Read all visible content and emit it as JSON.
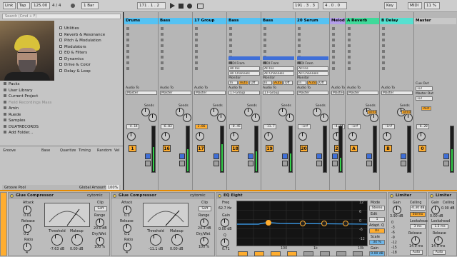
{
  "toolbar": {
    "link": "Link",
    "tap": "Tap",
    "tempo": "125.00",
    "meter_num": "4",
    "meter_den": "4",
    "bar": "1 Bar",
    "position": "171 . 1 . 2",
    "loop_pos": "191 . 3 . 3",
    "loop_len": "4 . 0 . 0",
    "key": "Key",
    "midi": "MIDI",
    "cpu": "11 %"
  },
  "browser": {
    "search_placeholder": "Search (Cmd + F)",
    "items": [
      "Utilities",
      "Reverb & Resonance",
      "Pitch & Modulation",
      "Modulators",
      "EQ & Filters",
      "Dynamics",
      "Drive & Color",
      "Delay & Loop"
    ],
    "places": [
      {
        "label": "Packs"
      },
      {
        "label": "User Library"
      },
      {
        "label": "Current Project"
      },
      {
        "label": "Field Recordings Mass",
        "dim": true
      },
      {
        "label": "Amin"
      },
      {
        "label": "Ruede"
      },
      {
        "label": "Samples"
      },
      {
        "label": "DUATRECORDS"
      },
      {
        "label": "Add Folder..."
      }
    ]
  },
  "groove": {
    "cols": [
      "Groove",
      "Base",
      "Quantize",
      "Timing",
      "Random",
      "Vel"
    ],
    "pool": "Groove Pool",
    "global_amount_label": "Global Amount",
    "global_amount": "100%"
  },
  "tracks": [
    {
      "name": "Drums",
      "color": "#55c2f3",
      "audio_to": "Audio To",
      "out": "Master",
      "vol": "-4.14",
      "num": "1",
      "lvl": 0.55
    },
    {
      "name": "Bass",
      "color": "#55c2f3",
      "audio_to": "Audio To",
      "out": "Master",
      "vol": "-6.03",
      "num": "16",
      "lvl": 0.5
    },
    {
      "name": "17 Group",
      "color": "#55c2f3",
      "audio_to": "Audio To",
      "out": "Master",
      "vol": "2.86",
      "num": "17",
      "lvl": 0.62,
      "volhi": true
    },
    {
      "name": "Bass",
      "color": "#55c2f3",
      "midi_from": "MIDI From",
      "midi_from_v": "All Ins",
      "midi_ch": "All Channels",
      "monitor": "Monitor",
      "in": "In",
      "auto": "Auto",
      "off": "Off",
      "audio_to": "Audio To",
      "out": "17-Group",
      "vol": "-0.45",
      "num": "18",
      "lvl": 0.45
    },
    {
      "name": "Bass",
      "color": "#55c2f3",
      "midi_from": "MIDI From",
      "midi_from_v": "All Ins",
      "midi_ch": "All Channels",
      "monitor": "Monitor",
      "in": "In",
      "auto": "Auto",
      "off": "Off",
      "audio_to": "Audio To",
      "out": "17-Group",
      "vol": "-11.7",
      "num": "19",
      "lvl": 0.4
    },
    {
      "name": "20 Serum",
      "color": "#55c2f3",
      "midi_from": "MIDI From",
      "midi_from_v": "All Ins",
      "midi_ch": "All Channels",
      "monitor": "Monitor",
      "in": "In",
      "auto": "Auto",
      "off": "Off",
      "audio_to": "Audio To",
      "out": "Master",
      "vol": "-inf",
      "num": "20",
      "lvl": 0.0
    },
    {
      "name": "Melodic",
      "color": "#b39ee9",
      "audio_to": "Audio To",
      "out": "Master",
      "vol": "-4.44",
      "num": "21",
      "lvl": 0.3
    },
    {
      "name": "A Reverb",
      "color": "#3fd99a",
      "audio_to": "Audio To",
      "out": "Master",
      "vol": "-inf",
      "num": "A",
      "lvl": 0.0
    },
    {
      "name": "B Delay",
      "color": "#56e0d0",
      "audio_to": "Audio To",
      "out": "Master",
      "vol": "-inf",
      "num": "B",
      "lvl": 0.0
    },
    {
      "name": "Master",
      "color": "#c8c8c8",
      "cue_out": "Cue Out",
      "cue_v": "1/2",
      "master_out": "Master Out",
      "master_v": "1/2",
      "vol": "-6.20",
      "num": "0",
      "lvl": 0.5,
      "post": "Post"
    }
  ],
  "sends_label": "Sends",
  "devices": {
    "glue1": {
      "title": "Glue Compressor",
      "brand": "cytomic",
      "attack": "Attack",
      "attack_v": "0.01",
      "release": "Release",
      "release_v": "0.2",
      "ratio": "Ratio",
      "ratio_v": "4",
      "threshold": "Threshold",
      "threshold_v": "-7.63 dB",
      "makeup": "Makeup",
      "makeup_v": "0.00 dB",
      "clip": "Clip",
      "clip_v": "Soft",
      "range": "Range",
      "range_v": "20.0 dB",
      "drywet": "Dry/Wet",
      "drywet_v": "100 %"
    },
    "glue2": {
      "title": "Glue Compressor",
      "brand": "cytomic",
      "attack": "Attack",
      "attack_v": "0.3",
      "release": "Release",
      "release_v": "0.2",
      "ratio": "Ratio",
      "ratio_v": "4",
      "threshold": "Threshold",
      "threshold_v": "-11.1 dB",
      "makeup": "Makeup",
      "makeup_v": "0.00 dB",
      "clip": "Clip",
      "clip_v": "Soft",
      "range": "Range",
      "range_v": "24.3 dB",
      "drywet": "Dry/Wet",
      "drywet_v": "100 %"
    },
    "eq": {
      "title": "EQ Eight",
      "freq": "Freq",
      "freq_v": "62.7 Hz",
      "gain": "Gain",
      "gain_v": "0.00 dB",
      "q": "Q",
      "q_v": "0.71",
      "mode": "Mode",
      "mode_v": "Stereo",
      "edit": "Edit",
      "edit_v": "1",
      "adapt": "Adapt. Q",
      "adapt_v": "On",
      "scale": "Scale",
      "scale_v": "34 %",
      "out_gain": "Gain",
      "out_gain_v": "0.00 dB",
      "freq_ticks": [
        "100",
        "1k",
        "10k"
      ],
      "db_ticks": [
        "12",
        "6",
        "0",
        "-6",
        "-12"
      ]
    },
    "lim1": {
      "title": "Limiter",
      "gain": "Gain",
      "gain_v": "3.90 dB",
      "ceiling": "Ceiling",
      "ceiling_v": "-0.30 dB",
      "stereo": "Stereo",
      "lookahead": "Lookahead",
      "lookahead_v": "3 ms",
      "release": "Release",
      "release_v": "14.9 ms",
      "auto": "Auto",
      "scale": [
        "0",
        "-3",
        "-6",
        "-9",
        "-12",
        "-15",
        "-18"
      ]
    },
    "lim2": {
      "title": "Limiter",
      "gain": "Gain",
      "gain_v": "0.00 dB",
      "ceiling": "Ceiling",
      "ceiling_v": "0.00 dB",
      "lookahead": "Lookahead",
      "lookahead_v": "1.5 ms",
      "release": "Release",
      "release_v": "14.9 ms",
      "auto": "Auto"
    }
  },
  "colors": {
    "accent": "#ffad2f",
    "orange_bar": "#e68a00",
    "meter": "#33d04a"
  }
}
